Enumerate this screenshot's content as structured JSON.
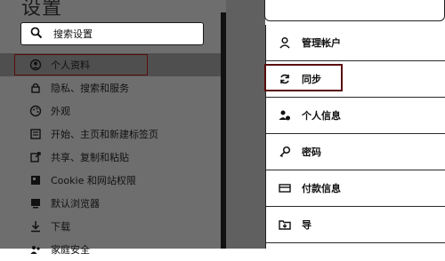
{
  "settings": {
    "title": "设置",
    "search_placeholder": "搜索设置"
  },
  "nav": {
    "items": [
      {
        "label": "个人资料",
        "icon": "profile-icon"
      },
      {
        "label": "隐私、搜索和服务",
        "icon": "lock-icon"
      },
      {
        "label": "外观",
        "icon": "appearance-icon"
      },
      {
        "label": "开始、主页和新建标签页",
        "icon": "home-icon"
      },
      {
        "label": "共享、复制和粘贴",
        "icon": "share-icon"
      },
      {
        "label": "Cookie 和网站权限",
        "icon": "cookie-icon"
      },
      {
        "label": "默认浏览器",
        "icon": "browser-icon"
      },
      {
        "label": "下载",
        "icon": "download-icon"
      },
      {
        "label": "家庭安全",
        "icon": "family-icon"
      }
    ]
  },
  "profile_panel": {
    "items": [
      {
        "label": "管理帐户",
        "icon": "person-icon"
      },
      {
        "label": "同步",
        "icon": "sync-icon"
      },
      {
        "label": "个人信息",
        "icon": "personal-info-icon"
      },
      {
        "label": "密码",
        "icon": "key-icon"
      },
      {
        "label": "付款信息",
        "icon": "card-icon"
      },
      {
        "label": "导",
        "icon": "import-icon"
      }
    ]
  }
}
